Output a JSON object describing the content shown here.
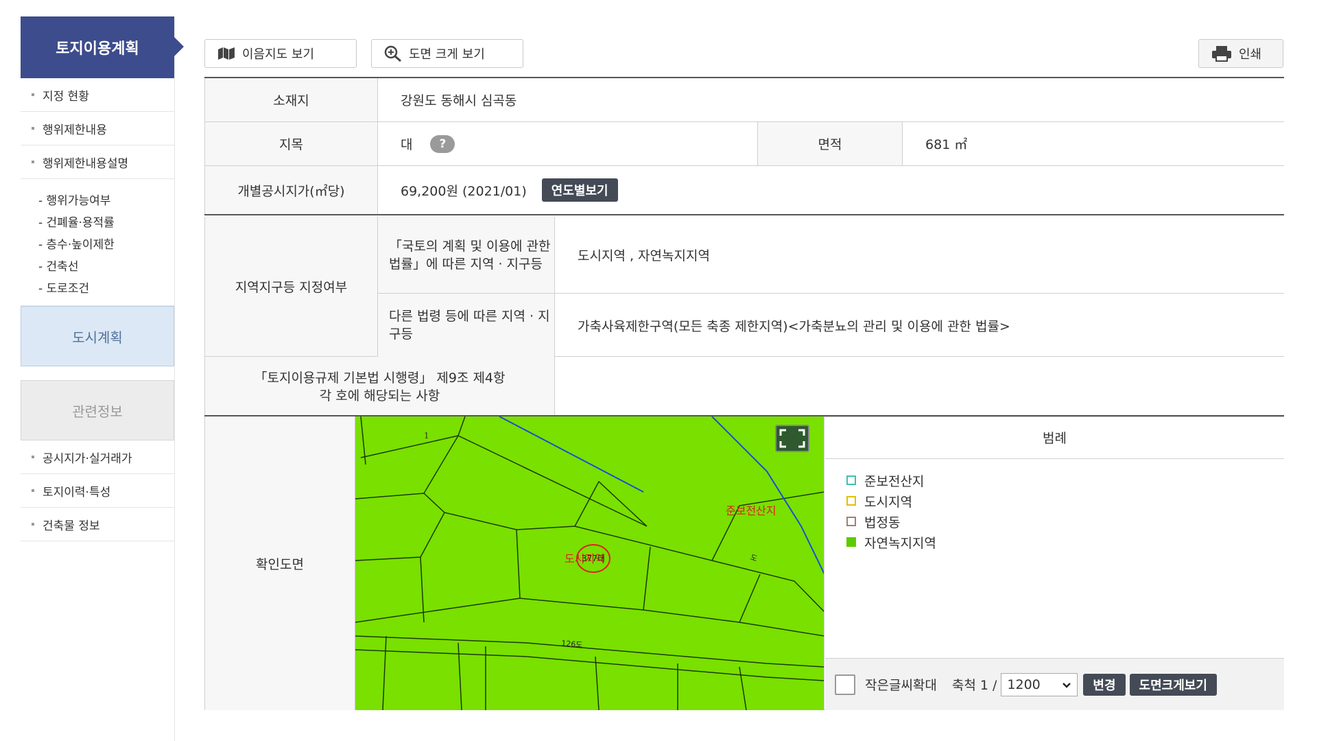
{
  "sidebar": {
    "title": "토지이용계획",
    "items_top": [
      "지정 현황",
      "행위제한내용",
      "행위제한내용설명"
    ],
    "sub_items": [
      "- 행위가능여부",
      "- 건폐율·용적률",
      "- 층수·높이제한",
      "- 건축선",
      "- 도로조건"
    ],
    "urban_plan": "도시계획",
    "related": "관련정보",
    "items_bottom": [
      "공시지가·실거래가",
      "토지이력·특성",
      "건축물 정보"
    ]
  },
  "toolbar": {
    "map_view": "이음지도 보기",
    "enlarge_view": "도면 크게 보기",
    "print": "인쇄"
  },
  "info": {
    "location_label": "소재지",
    "location_value": "강원도 동해시 심곡동",
    "jimok_label": "지목",
    "jimok_value": "대",
    "help_icon": "?",
    "area_label": "면적",
    "area_value": "681 ㎡",
    "price_label": "개별공시지가(㎡당)",
    "price_value": "69,200원 (2021/01)",
    "yearly_button": "연도별보기",
    "zone_label": "지역지구등 지정여부",
    "zone_law_label": "「국토의 계획 및 이용에 관한 법률」에 따른 지역 · 지구등",
    "zone_law_value": "도시지역 , 자연녹지지역",
    "zone_other_label": "다른 법령 등에 따른 지역 · 지구등",
    "zone_other_value": "가축사육제한구역(모든 축종 제한지역)<가축분뇨의 관리 및 이용에 관한 법률>",
    "regulation_label": "「토지이용규제 기본법 시행령」 제9조 제4항 각 호에 해당되는 사항",
    "regulation_value": ""
  },
  "map": {
    "label": "확인도면",
    "map_texts": {
      "parcel_1": "1",
      "zone_a": "준보전산지",
      "zone_b": "도시지역",
      "parcel_main": "377대",
      "road_a": "도",
      "road_b": "126도"
    },
    "legend_title": "범례",
    "legend": [
      {
        "label": "준보전산지",
        "color": "#3ec0b0",
        "filled": false
      },
      {
        "label": "도시지역",
        "color": "#e0c000",
        "filled": false
      },
      {
        "label": "법정동",
        "color": "#a08070",
        "filled": false
      },
      {
        "label": "자연녹지지역",
        "color": "#5ccc00",
        "filled": true
      }
    ],
    "small_text_label": "작은글씨확대",
    "scale_label": "축척 1 /",
    "scale_value": "1200",
    "change_button": "변경",
    "big_map_button": "도면크게보기"
  }
}
